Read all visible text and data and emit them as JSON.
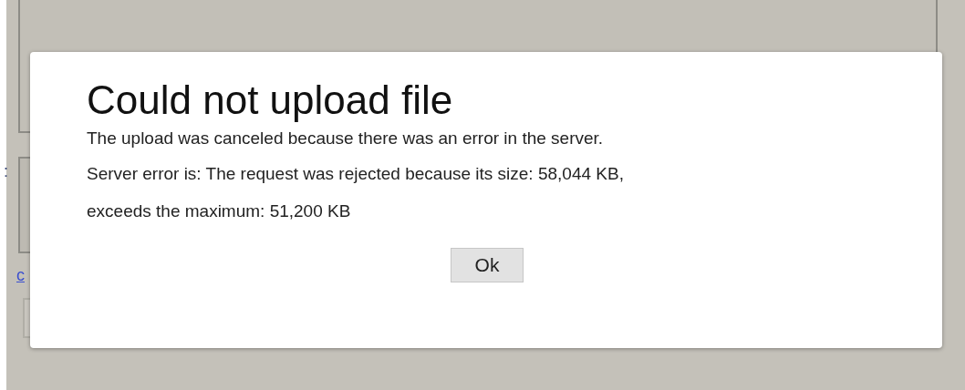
{
  "background": {
    "label": ":",
    "link": "c"
  },
  "dialog": {
    "title": "Could not upload file",
    "message": [
      "The upload was canceled because there was an error in the server.",
      "Server error is: The request was rejected because its size: 58,044 KB,",
      "exceeds the maximum: 51,200 KB"
    ],
    "buttons": [
      "Ok"
    ]
  }
}
